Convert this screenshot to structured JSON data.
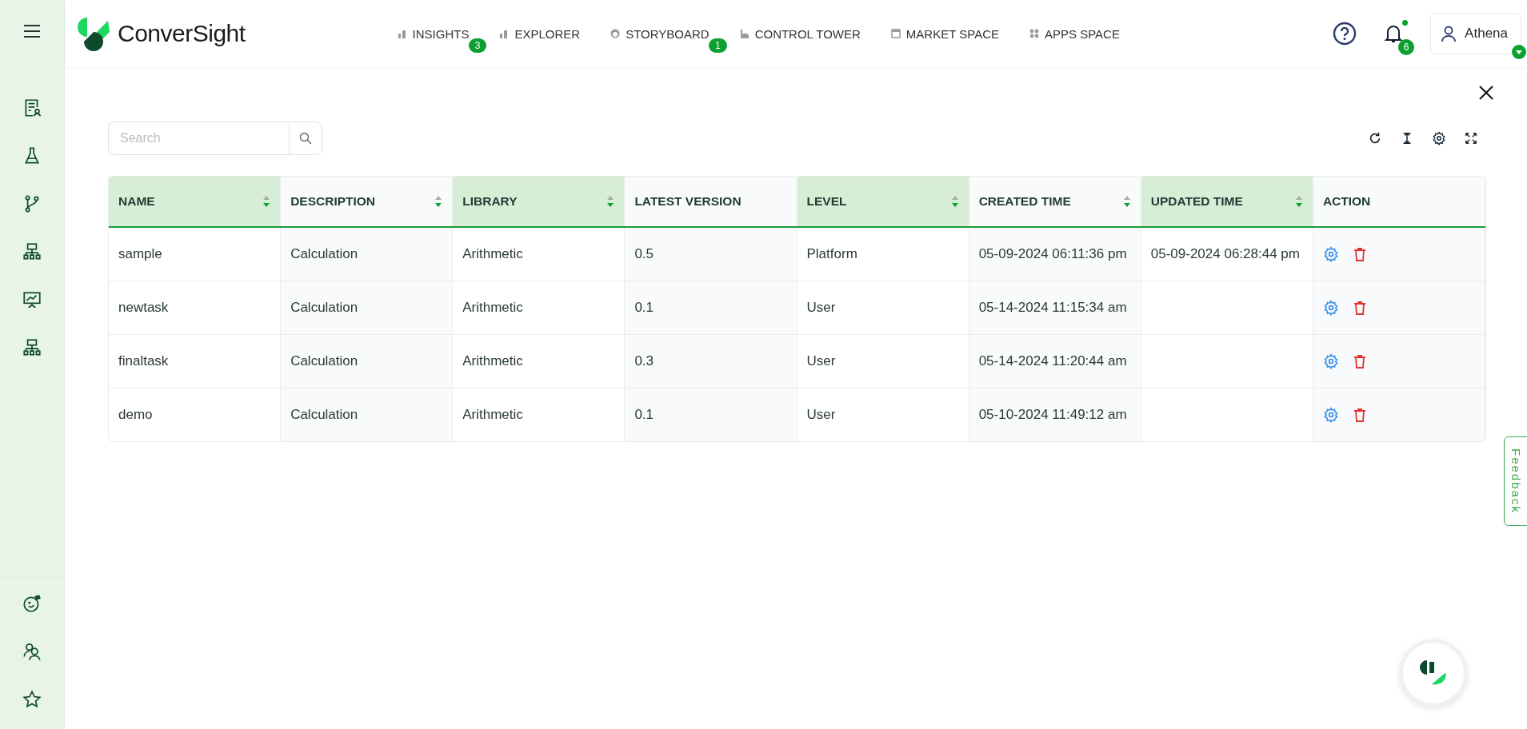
{
  "brand": {
    "name": "ConverSight"
  },
  "nav": [
    {
      "label": "INSIGHTS",
      "kind": "chart",
      "badge": "3"
    },
    {
      "label": "EXPLORER",
      "kind": "chart"
    },
    {
      "label": "STORYBOARD",
      "kind": "gauge",
      "badge": "1"
    },
    {
      "label": "CONTROL TOWER",
      "kind": "factory"
    },
    {
      "label": "MARKET SPACE",
      "kind": "store"
    },
    {
      "label": "APPS SPACE",
      "kind": "grid"
    }
  ],
  "notifications": {
    "count": "6",
    "unread": true
  },
  "user": {
    "name": "Athena"
  },
  "search": {
    "placeholder": "Search"
  },
  "table": {
    "columns": [
      {
        "label": "NAME",
        "sortable": true
      },
      {
        "label": "DESCRIPTION",
        "sortable": true
      },
      {
        "label": "LIBRARY",
        "sortable": true
      },
      {
        "label": "LATEST VERSION",
        "sortable": false
      },
      {
        "label": "LEVEL",
        "sortable": true
      },
      {
        "label": "CREATED TIME",
        "sortable": true
      },
      {
        "label": "UPDATED TIME",
        "sortable": true
      },
      {
        "label": "ACTION",
        "sortable": false
      }
    ],
    "rows": [
      {
        "cells": [
          "sample",
          "Calculation",
          "Arithmetic",
          "0.5",
          "Platform",
          "05-09-2024 06:11:36 pm",
          "05-09-2024 06:28:44 pm"
        ]
      },
      {
        "cells": [
          "newtask",
          "Calculation",
          "Arithmetic",
          "0.1",
          "User",
          "05-14-2024 11:15:34 am",
          ""
        ]
      },
      {
        "cells": [
          "finaltask",
          "Calculation",
          "Arithmetic",
          "0.3",
          "User",
          "05-14-2024 11:20:44 am",
          ""
        ]
      },
      {
        "cells": [
          "demo",
          "Calculation",
          "Arithmetic",
          "0.1",
          "User",
          "05-10-2024 11:49:12 am",
          ""
        ]
      }
    ]
  },
  "feedback": {
    "label": "Feedback"
  }
}
